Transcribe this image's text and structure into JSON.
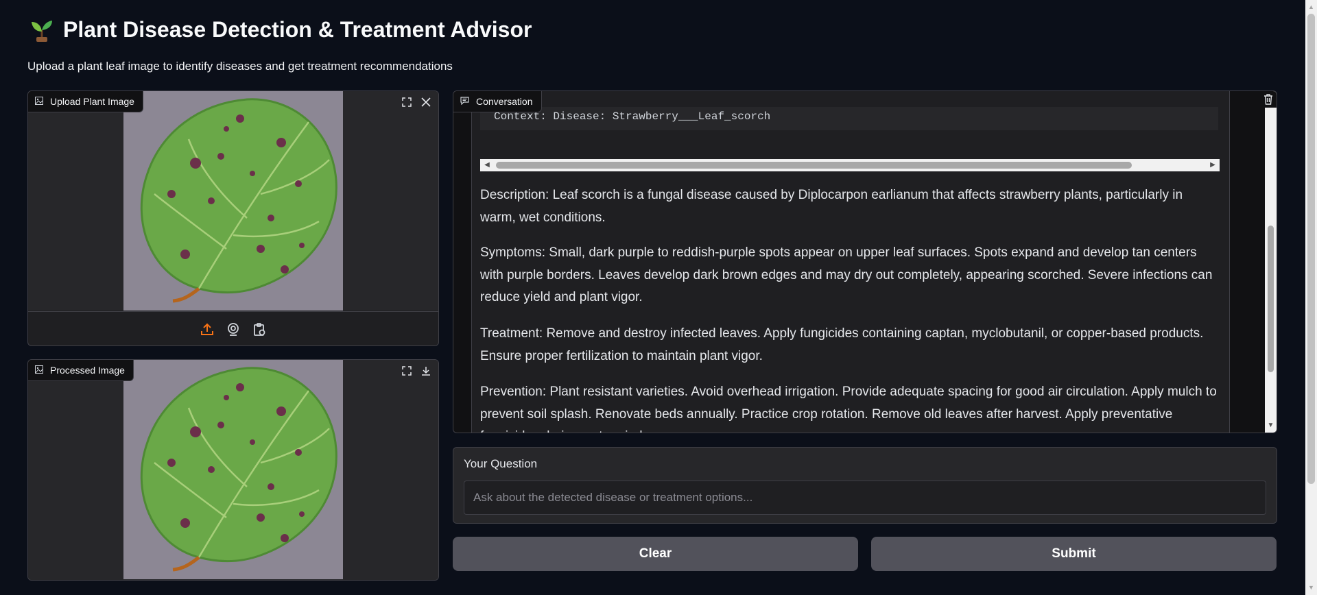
{
  "app": {
    "title": "Plant Disease Detection & Treatment Advisor",
    "subtitle": "Upload a plant leaf image to identify diseases and get treatment recommendations",
    "logo_icon": "seedling-icon"
  },
  "upload_panel": {
    "label": "Upload Plant Image",
    "label_icon": "image-icon",
    "corner_icons": [
      "fullscreen-icon",
      "close-icon"
    ],
    "toolbar_icons": [
      "upload-icon",
      "webcam-icon",
      "clipboard-icon"
    ]
  },
  "processed_panel": {
    "label": "Processed Image",
    "label_icon": "image-icon",
    "corner_icons": [
      "fullscreen-icon",
      "download-icon"
    ]
  },
  "chat": {
    "label": "Conversation",
    "label_icon": "chat-icon",
    "code_line": "Context: Disease: Strawberry___Leaf_scorch",
    "paragraphs": [
      "Description: Leaf scorch is a fungal disease caused by Diplocarpon earlianum that affects strawberry plants, particularly in warm, wet conditions.",
      "Symptoms: Small, dark purple to reddish-purple spots appear on upper leaf surfaces. Spots expand and develop tan centers with purple borders. Leaves develop dark brown edges and may dry out completely, appearing scorched. Severe infections can reduce yield and plant vigor.",
      "Treatment: Remove and destroy infected leaves. Apply fungicides containing captan, myclobutanil, or copper-based products. Ensure proper fertilization to maintain plant vigor.",
      "Prevention: Plant resistant varieties. Avoid overhead irrigation. Provide adequate spacing for good air circulation. Apply mulch to prevent soil splash. Renovate beds annually. Practice crop rotation. Remove old leaves after harvest. Apply preventative fungicides during wet periods."
    ],
    "clear_icon": "trash-icon"
  },
  "question": {
    "label": "Your Question",
    "placeholder": "Ask about the detected disease or treatment options...",
    "value": ""
  },
  "buttons": {
    "clear": "Clear",
    "submit": "Submit"
  },
  "colors": {
    "background": "#0b0f19",
    "panel": "#1f1f22",
    "border": "#3f3f46",
    "button": "#52525b",
    "upload_accent": "#f97316"
  }
}
